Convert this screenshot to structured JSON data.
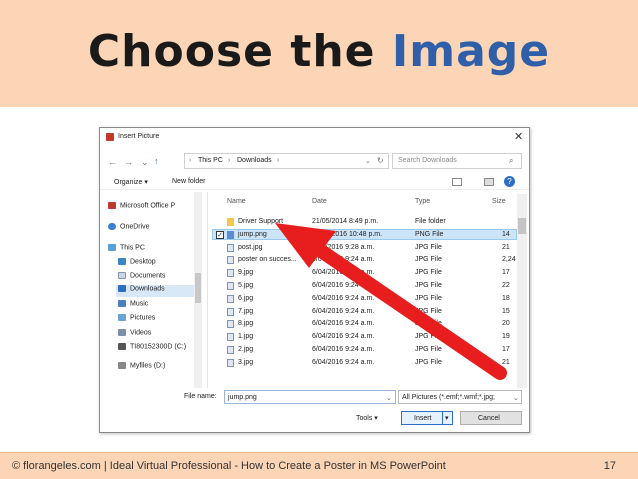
{
  "slide": {
    "title_part1": "Choose the",
    "title_part2": "Image",
    "accent_color": "#2e5fa8",
    "band_color": "#fbd5b5"
  },
  "dialog": {
    "window_title": "Insert Picture",
    "close_icon": "close-icon",
    "breadcrumb": [
      "This PC",
      "Downloads"
    ],
    "search_placeholder": "Search Downloads",
    "toolbar": {
      "organize": "Organize ▾",
      "new_folder": "New folder"
    },
    "sidebar": [
      {
        "label": "Microsoft Office P",
        "icon": "office-icon"
      },
      {
        "label": "OneDrive",
        "icon": "cloud-icon"
      },
      {
        "label": "This PC",
        "icon": "computer-icon"
      },
      {
        "label": "Desktop",
        "icon": "desktop-icon"
      },
      {
        "label": "Documents",
        "icon": "documents-icon"
      },
      {
        "label": "Downloads",
        "icon": "downloads-icon"
      },
      {
        "label": "Music",
        "icon": "music-icon"
      },
      {
        "label": "Pictures",
        "icon": "pictures-icon"
      },
      {
        "label": "Videos",
        "icon": "videos-icon"
      },
      {
        "label": "TI80152300D (C:)",
        "icon": "drive-icon"
      },
      {
        "label": "Myfiles (D:)",
        "icon": "drive-icon"
      }
    ],
    "columns": [
      "Name",
      "Date",
      "Type",
      "Size"
    ],
    "files": [
      {
        "name": "Driver Support",
        "date": "21/05/2014 8:49 p.m.",
        "type": "File folder",
        "size": ""
      },
      {
        "name": "jump.png",
        "date": "20/04/2016 10:48 p.m.",
        "type": "PNG File",
        "size": "14"
      },
      {
        "name": "post.jpg",
        "date": "6/04/2016 9:28 a.m.",
        "type": "JPG File",
        "size": "21"
      },
      {
        "name": "poster on succes...",
        "date": "6/04/2016 9:24 a.m.",
        "type": "JPG File",
        "size": "2,24"
      },
      {
        "name": "9.jpg",
        "date": "6/04/2016 9:24 a.m.",
        "type": "JPG File",
        "size": "17"
      },
      {
        "name": "5.jpg",
        "date": "6/04/2016 9:24 a.m.",
        "type": "JPG File",
        "size": "22"
      },
      {
        "name": "6.jpg",
        "date": "6/04/2016 9:24 a.m.",
        "type": "JPG File",
        "size": "18"
      },
      {
        "name": "7.jpg",
        "date": "6/04/2016 9:24 a.m.",
        "type": "JPG File",
        "size": "15"
      },
      {
        "name": "8.jpg",
        "date": "6/04/2016 9:24 a.m.",
        "type": "JPG File",
        "size": "20"
      },
      {
        "name": "1.jpg",
        "date": "6/04/2016 9:24 a.m.",
        "type": "JPG File",
        "size": "19"
      },
      {
        "name": "2.jpg",
        "date": "6/04/2016 9:24 a.m.",
        "type": "JPG File",
        "size": "17"
      },
      {
        "name": "3.jpg",
        "date": "6/04/2016 9:24 a.m.",
        "type": "JPG File",
        "size": "21"
      }
    ],
    "filename_label": "File name:",
    "filename_value": "jump.png",
    "filetype_value": "All Pictures (*.emf;*.wmf;*.jpg;",
    "tools_label": "Tools ▾",
    "insert_label": "Insert",
    "cancel_label": "Cancel"
  },
  "footer": {
    "text": "© florangeles.com | Ideal Virtual Professional - How to Create a Poster in MS PowerPoint",
    "page_number": "17"
  }
}
